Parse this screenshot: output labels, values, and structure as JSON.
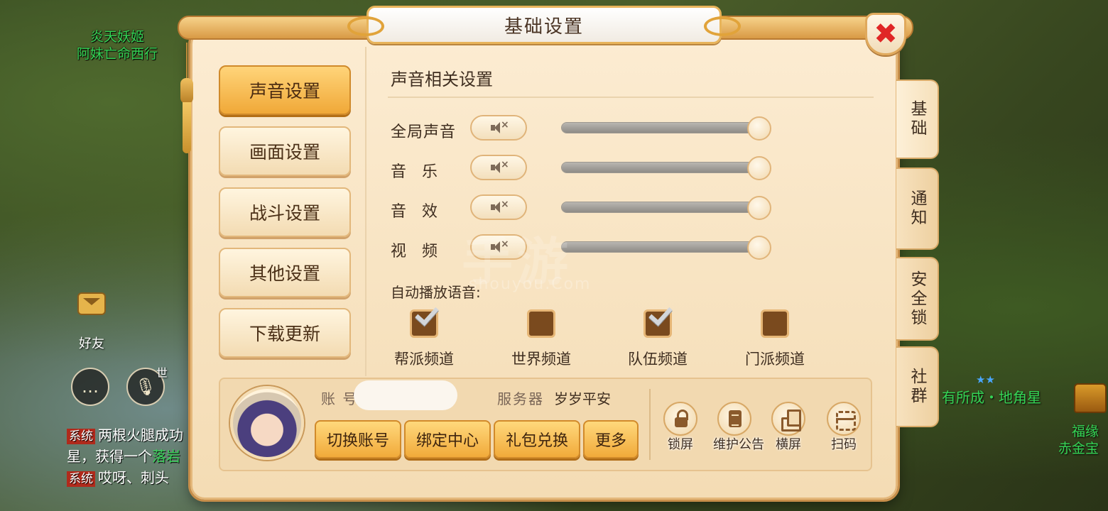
{
  "background": {
    "npc_name_line1": "炎天妖姬",
    "npc_name_line2": "阿妹亡命西行",
    "friend_label": "好友",
    "world_tag": "世",
    "chat": [
      {
        "tag": "系统",
        "text": "两根火腿成功"
      },
      {
        "tag": "",
        "text": "星，获得一个",
        "highlight": "落岩"
      },
      {
        "tag": "系统",
        "text": "哎呀、刺头"
      }
    ],
    "right_label": "有所成・地角星",
    "right_label2_line1": "福缘",
    "right_label2_line2": "赤金宝"
  },
  "dialog": {
    "title": "基础设置",
    "close_icon": "✖",
    "menu": [
      {
        "label": "声音设置",
        "active": true
      },
      {
        "label": "画面设置",
        "active": false
      },
      {
        "label": "战斗设置",
        "active": false
      },
      {
        "label": "其他设置",
        "active": false
      },
      {
        "label": "下载更新",
        "active": false
      }
    ],
    "section_title": "声音相关设置",
    "sound_rows": [
      {
        "label": "全局声音",
        "level": 1.0,
        "spread": false
      },
      {
        "label": "音乐",
        "level": 1.0,
        "spread": true
      },
      {
        "label": "音效",
        "level": 1.0,
        "spread": true
      },
      {
        "label": "视频",
        "level": 1.0,
        "spread": true
      }
    ],
    "auto_voice_label": "自动播放语音:",
    "auto_voice_channels": [
      {
        "label": "帮派频道",
        "checked": true
      },
      {
        "label": "世界频道",
        "checked": false
      },
      {
        "label": "队伍频道",
        "checked": true
      },
      {
        "label": "门派频道",
        "checked": false
      }
    ],
    "account": {
      "account_label": "账 号",
      "account_value": "",
      "server_label": "服务器",
      "server_value": "岁岁平安",
      "buttons": [
        "切换账号",
        "绑定中心",
        "礼包兑换",
        "更多"
      ],
      "tools": [
        {
          "label": "锁屏",
          "icon": "lock-icon"
        },
        {
          "label": "维护公告",
          "icon": "notice-icon"
        },
        {
          "label": "横屏",
          "icon": "rotate-screen-icon"
        },
        {
          "label": "扫码",
          "icon": "scan-qr-icon"
        }
      ]
    },
    "side_tabs": [
      {
        "label": "基础",
        "active": true
      },
      {
        "label": "通知",
        "active": false
      },
      {
        "label": "安全锁",
        "active": false
      },
      {
        "label": "社群",
        "active": false
      }
    ]
  },
  "watermark": {
    "main": "手游",
    "sub": "shouyou.Com"
  },
  "colors": {
    "accent_orange": "#f0a838",
    "panel_bg": "#fcecd2",
    "close_red": "#e02626",
    "npc_green": "#35d455"
  }
}
